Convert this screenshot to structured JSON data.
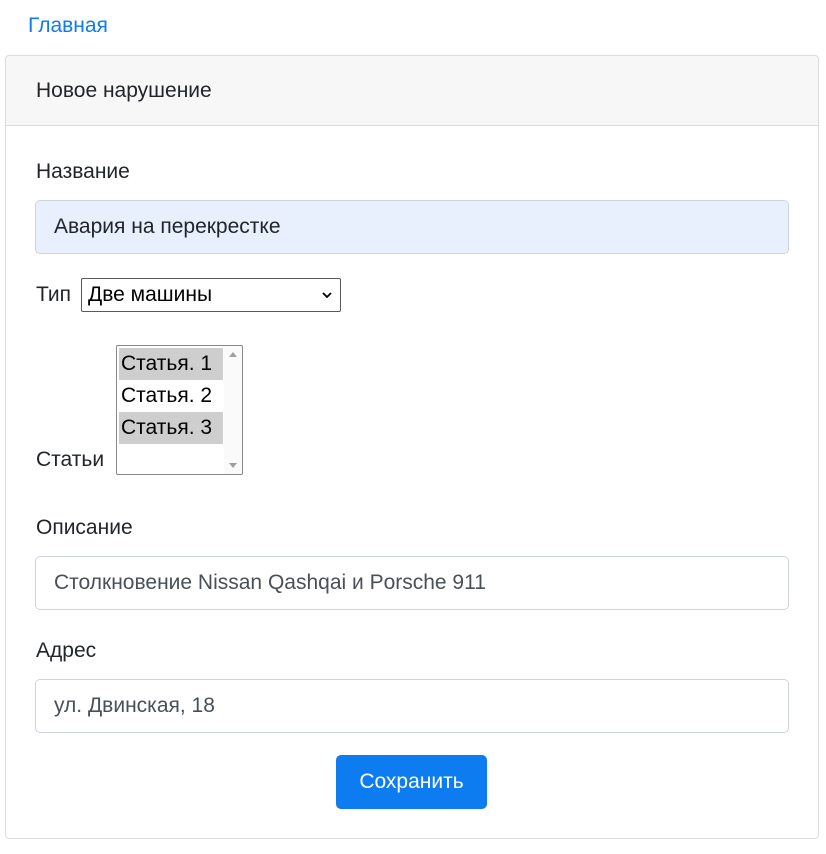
{
  "nav": {
    "home_link": "Главная"
  },
  "form": {
    "header_title": "Новое нарушение",
    "name": {
      "label": "Название",
      "value": "Авария на перекрестке"
    },
    "type": {
      "label": "Тип",
      "selected": "Две машины"
    },
    "articles": {
      "label": "Статьи",
      "options": [
        {
          "label": "Статья. 1",
          "selected": true
        },
        {
          "label": "Статья. 2",
          "selected": false
        },
        {
          "label": "Статья. 3",
          "selected": true
        }
      ]
    },
    "description": {
      "label": "Описание",
      "value": "Столкновение Nissan Qashqai и Porsche 911"
    },
    "address": {
      "label": "Адрес",
      "value": "ул. Двинская, 18"
    },
    "save_label": "Сохранить"
  },
  "colors": {
    "accent": "#0d7cf0",
    "autofill_bg": "#e8f0fe",
    "selected_option_bg": "#cecece",
    "header_bg": "#f7f7f7"
  }
}
